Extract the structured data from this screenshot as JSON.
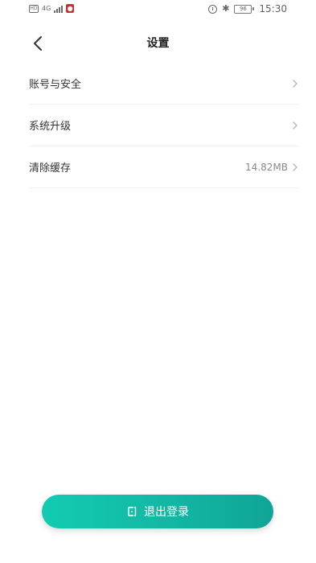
{
  "status_bar": {
    "hd": "HD",
    "network": "4G",
    "battery": "96",
    "time": "15:30",
    "mic_icon": "mic-icon"
  },
  "header": {
    "title": "设置",
    "back_icon": "chevron-left-icon"
  },
  "list": [
    {
      "label": "账号与安全",
      "value": ""
    },
    {
      "label": "系统升级",
      "value": ""
    },
    {
      "label": "清除缓存",
      "value": "14.82MB"
    }
  ],
  "logout": {
    "label": "退出登录",
    "icon": "logout-icon"
  },
  "colors": {
    "accent_start": "#12ccb0",
    "accent_end": "#0fa497"
  }
}
